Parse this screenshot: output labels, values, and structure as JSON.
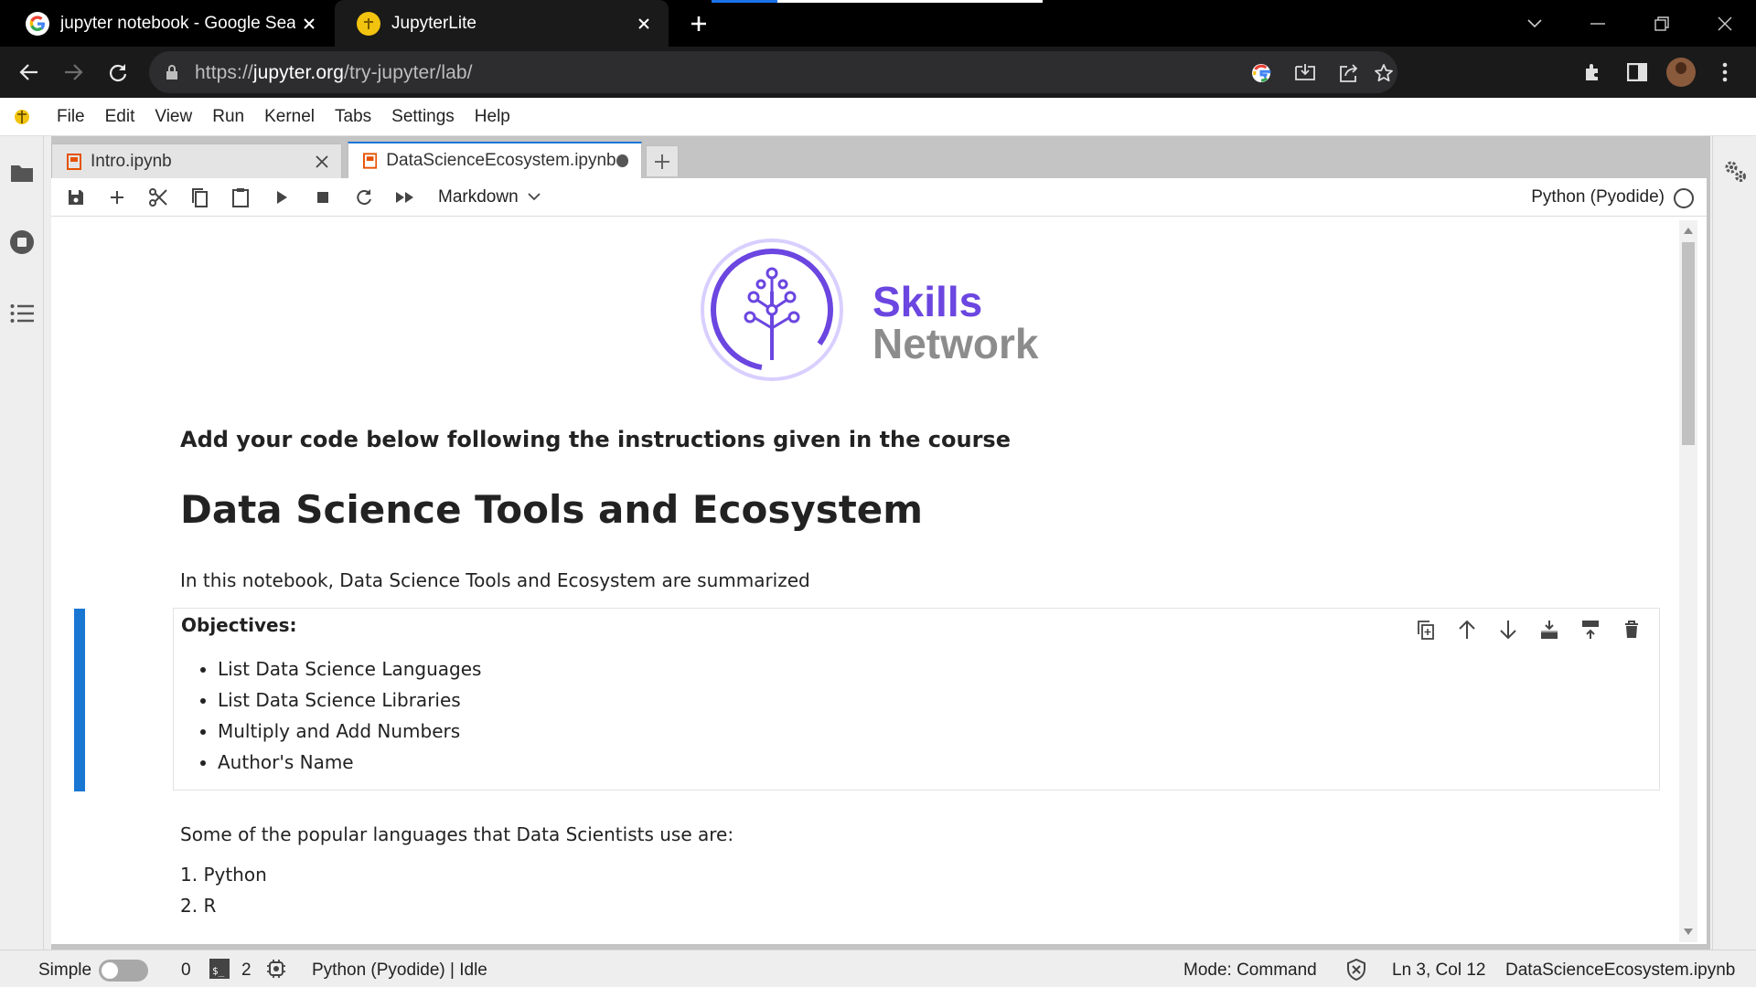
{
  "browser": {
    "tabs": [
      {
        "title": "jupyter notebook - Google Search",
        "active": false
      },
      {
        "title": "JupyterLite",
        "active": true
      }
    ],
    "url_scheme": "https://",
    "url_host": "jupyter.org",
    "url_path": "/try-jupyter/lab/"
  },
  "menu": {
    "items": [
      "File",
      "Edit",
      "View",
      "Run",
      "Kernel",
      "Tabs",
      "Settings",
      "Help"
    ]
  },
  "doc_tabs": [
    {
      "label": "Intro.ipynb"
    },
    {
      "label": "DataScienceEcosystem.ipynb"
    }
  ],
  "toolbar": {
    "cell_type": "Markdown",
    "kernel_name": "Python (Pyodide)"
  },
  "notebook": {
    "logo_line1": "Skills",
    "logo_line2": "Network",
    "instructions": "Add your code below following the instructions given in the course",
    "heading": "Data Science Tools and Ecosystem",
    "intro": "In this notebook, Data Science Tools and Ecosystem are summarized",
    "objectives_title": "Objectives:",
    "objectives": [
      "List Data Science Languages",
      "List Data Science Libraries",
      "Multiply and Add Numbers",
      "Author's Name"
    ],
    "languages_intro": "Some of the popular languages that Data Scientists use are:",
    "languages": [
      "1. Python",
      "2. R"
    ]
  },
  "statusbar": {
    "mode_toggle_label": "Simple",
    "terminals": "0",
    "kernels": "2",
    "kernel_status": "Python (Pyodide) | Idle",
    "mode": "Mode: Command",
    "cursor": "Ln 3, Col 12",
    "filename": "DataScienceEcosystem.ipynb"
  },
  "colors": {
    "accent": "#1976d2",
    "skills_purple": "#6b46e0",
    "network_gray": "#8c8c8c"
  }
}
